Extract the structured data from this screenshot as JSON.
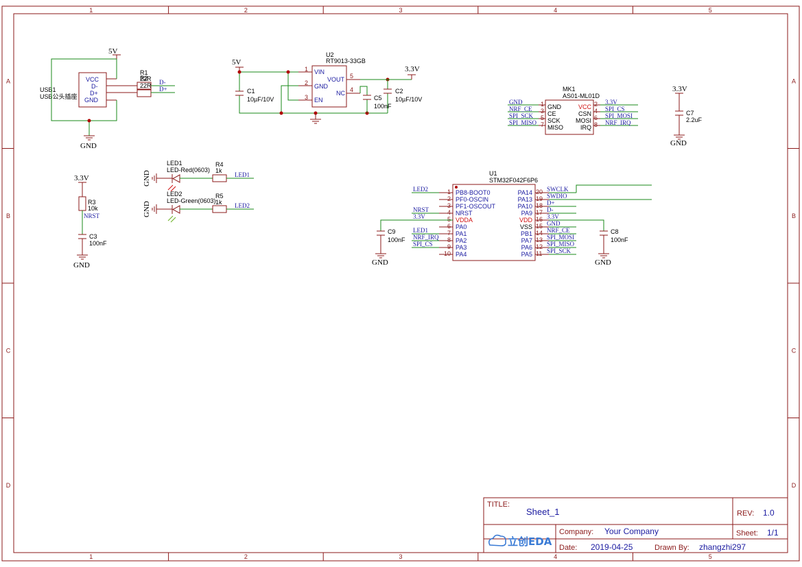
{
  "zones": {
    "columns": [
      "1",
      "2",
      "3",
      "4",
      "5"
    ],
    "rows": [
      "A",
      "B",
      "C",
      "D"
    ]
  },
  "usb": {
    "ref": "USB1",
    "value": "USB公头插座",
    "pins": [
      "VCC",
      "D-",
      "D+",
      "GND"
    ]
  },
  "r1": {
    "ref": "R1",
    "value": "22R"
  },
  "r2": {
    "ref": "R2",
    "value": "22R"
  },
  "usb_nets": {
    "dm": "D-",
    "dp": "D+"
  },
  "u2": {
    "ref": "U2",
    "value": "RT9013-33GB",
    "pins_left": [
      {
        "n": "1",
        "name": "VIN"
      },
      {
        "n": "2",
        "name": "GND"
      },
      {
        "n": "3",
        "name": "EN"
      }
    ],
    "pins_right": [
      {
        "n": "5",
        "name": "VOUT"
      },
      {
        "n": "4",
        "name": "NC"
      }
    ]
  },
  "c1": {
    "ref": "C1",
    "value": "10µF/10V"
  },
  "c5": {
    "ref": "C5",
    "value": "100nF"
  },
  "c2": {
    "ref": "C2",
    "value": "10µF/10V"
  },
  "mk1": {
    "ref": "MK1",
    "value": "AS01-ML01D",
    "pins_left": [
      {
        "n": "1",
        "name": "GND"
      },
      {
        "n": "3",
        "name": "CE"
      },
      {
        "n": "5",
        "name": "SCK"
      },
      {
        "n": "7",
        "name": "MISO"
      }
    ],
    "pins_right": [
      {
        "n": "2",
        "name": "VCC"
      },
      {
        "n": "4",
        "name": "CSN"
      },
      {
        "n": "6",
        "name": "MOSI"
      },
      {
        "n": "8",
        "name": "IRQ"
      }
    ],
    "nets_left": [
      "GND",
      "NRF_CE",
      "SPI_SCK",
      "SPI_MISO"
    ],
    "nets_right": [
      "3.3V",
      "SPI_CS",
      "SPI_MOSI",
      "NRF_IRQ"
    ]
  },
  "c7": {
    "ref": "C7",
    "value": "2.2uF"
  },
  "led1": {
    "ref": "LED1",
    "value": "LED-Red(0603)"
  },
  "led2": {
    "ref": "LED2",
    "value": "LED-Green(0603)"
  },
  "r4": {
    "ref": "R4",
    "value": "1k"
  },
  "r5": {
    "ref": "R5",
    "value": "1k"
  },
  "led_nets": {
    "led1": "LED1",
    "led2": "LED2"
  },
  "r3": {
    "ref": "R3",
    "value": "10k"
  },
  "nrst_net": "NRST",
  "c3": {
    "ref": "C3",
    "value": "100nF"
  },
  "u1": {
    "ref": "U1",
    "value": "STM32F042F6P6",
    "pins_left": [
      {
        "n": "1",
        "name": "PB8-BOOT0"
      },
      {
        "n": "2",
        "name": "PF0-OSCIN"
      },
      {
        "n": "3",
        "name": "PF1-OSCOUT"
      },
      {
        "n": "4",
        "name": "NRST"
      },
      {
        "n": "5",
        "name": "VDDA"
      },
      {
        "n": "6",
        "name": "PA0"
      },
      {
        "n": "7",
        "name": "PA1"
      },
      {
        "n": "8",
        "name": "PA2"
      },
      {
        "n": "9",
        "name": "PA3"
      },
      {
        "n": "10",
        "name": "PA4"
      }
    ],
    "pins_right": [
      {
        "n": "20",
        "name": "PA14"
      },
      {
        "n": "19",
        "name": "PA13"
      },
      {
        "n": "18",
        "name": "PA10"
      },
      {
        "n": "17",
        "name": "PA9"
      },
      {
        "n": "16",
        "name": "VDD"
      },
      {
        "n": "15",
        "name": "VSS"
      },
      {
        "n": "14",
        "name": "PB1"
      },
      {
        "n": "13",
        "name": "PA7"
      },
      {
        "n": "12",
        "name": "PA6"
      },
      {
        "n": "11",
        "name": "PA5"
      }
    ],
    "nets_left": [
      "LED2",
      "",
      "",
      "NRST",
      "3.3V",
      "",
      "LED1",
      "NRF_IRQ",
      "SPI_CS",
      ""
    ],
    "nets_right": [
      "SWCLK",
      "SWDIO",
      "D+",
      "D-",
      "3.3V",
      "GND",
      "NRF_CE",
      "SPI_MOSI",
      "SPI_MISO",
      "SPI_SCK"
    ]
  },
  "c9": {
    "ref": "C9",
    "value": "100nF"
  },
  "c8": {
    "ref": "C8",
    "value": "100nF"
  },
  "power": {
    "v5": "5V",
    "v33": "3.3V",
    "gnd": "GND"
  },
  "title_block": {
    "title_label": "TITLE:",
    "title": "Sheet_1",
    "rev_label": "REV:",
    "rev": "1.0",
    "company_label": "Company:",
    "company": "Your Company",
    "sheet_label": "Sheet:",
    "sheet": "1/1",
    "date_label": "Date:",
    "date": "2019-04-25",
    "drawn_label": "Drawn By:",
    "drawn": "zhangzhi297",
    "logo_text": "立创EDA"
  },
  "colors": {
    "frame": "#8b1a1a",
    "wire": "#1a8a1a",
    "pin_name": "#1a1aa0",
    "pin_red": "#d01010"
  }
}
